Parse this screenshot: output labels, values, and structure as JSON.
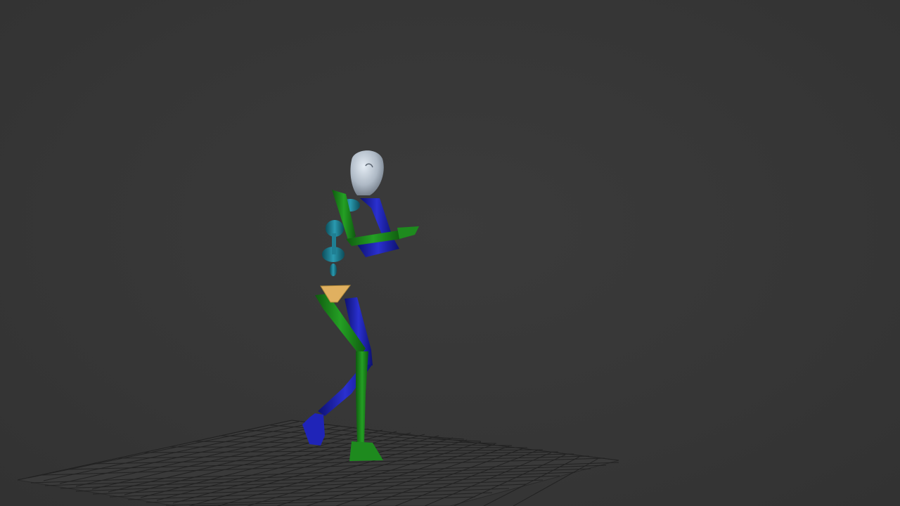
{
  "viewport": {
    "background_color": "#373737",
    "grid_color": "#1f1f1f"
  },
  "biped": {
    "head_color": "#b7c3cf",
    "spine_color": "#1f7f93",
    "pelvis_color": "#e0b060",
    "left_side_color": "#1e8a1e",
    "right_side_color": "#1f24b8"
  }
}
